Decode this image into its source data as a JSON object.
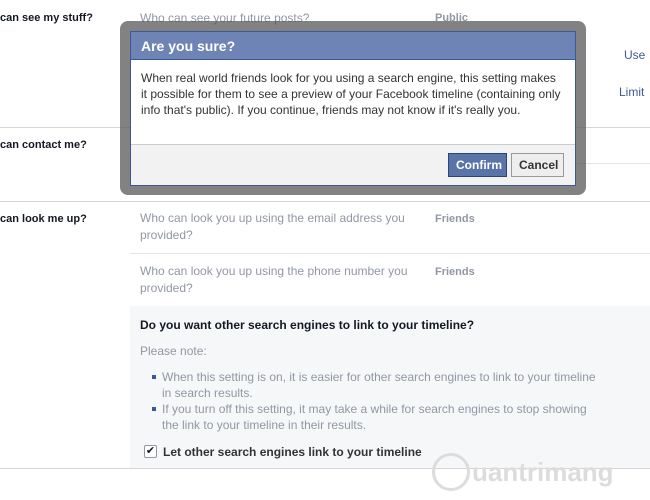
{
  "sections": {
    "stuff": {
      "label": "can see my stuff?",
      "rows": [
        {
          "question": "Who can see your future posts?",
          "value": "Public"
        }
      ],
      "links": [
        "Use",
        "Limit"
      ]
    },
    "contact": {
      "label": "can contact me?"
    },
    "lookup": {
      "label": "can look me up?",
      "rows": [
        {
          "question": "Who can look you up using the email address you provided?",
          "value": "Friends"
        },
        {
          "question": "Who can look you up using the phone number you provided?",
          "value": "Friends"
        }
      ]
    }
  },
  "search_engines": {
    "title": "Do you want other search engines to link to your timeline?",
    "note": "Please note:",
    "bullets": [
      "When this setting is on, it is easier for other search engines to link to your timeline in search results.",
      "If you turn off this setting, it may take a while for search engines to stop showing the link to your timeline in their results."
    ],
    "checkbox_label": "Let other search engines link to your timeline",
    "checkbox_checked": true,
    "checkbox_glyph": "✔"
  },
  "dialog": {
    "title": "Are you sure?",
    "body": "When real world friends look for you using a search engine, this setting makes it possible for them to see a preview of your Facebook timeline (containing only info that's public). If you continue, friends may not know if it's really you.",
    "confirm_label": "Confirm",
    "cancel_label": "Cancel"
  },
  "watermark": {
    "text": "uantrimang"
  },
  "colors": {
    "header_blue": "#6d84b4",
    "border_blue": "#3b5998",
    "confirm_blue": "#5b74a8",
    "muted_text": "#9197a3"
  }
}
